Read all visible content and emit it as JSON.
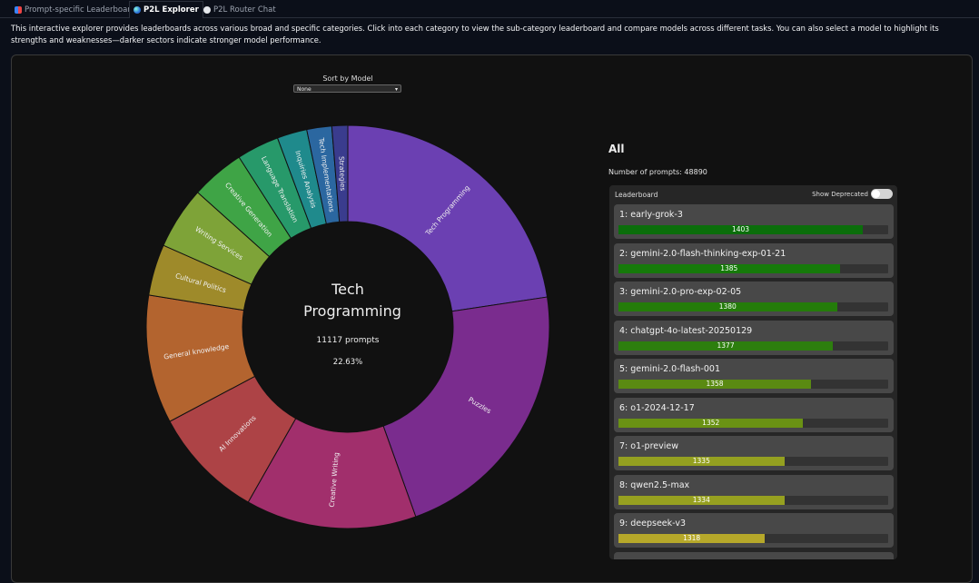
{
  "tabs": [
    {
      "label": "Prompt-specific Leaderboard",
      "icon": "bar-chart-icon",
      "active": false
    },
    {
      "label": "P2L Explorer",
      "icon": "globe-icon",
      "active": true
    },
    {
      "label": "P2L Router Chat",
      "icon": "speech-bubble-icon",
      "active": false
    }
  ],
  "description": "This interactive explorer provides leaderboards across various broad and specific categories. Click into each category to view the sub-category leaderboard and compare models across different tasks. You can also select a model to highlight its strengths and weaknesses—darker sectors indicate stronger model performance.",
  "sort": {
    "label": "Sort by Model",
    "value": "None"
  },
  "center": {
    "title_line1": "Tech",
    "title_line2": "Programming",
    "prompts": "11117 prompts",
    "percent": "22.63%"
  },
  "chart_data": {
    "type": "pie",
    "donut": true,
    "unit": "percent of prompts",
    "categories": [
      {
        "name": "Tech Programming",
        "share": 22.63,
        "color": "#6b40b2"
      },
      {
        "name": "Puzzles",
        "share": 21.9,
        "color": "#7a2c8e"
      },
      {
        "name": "Creative Writing",
        "share": 13.7,
        "color": "#a12f6c"
      },
      {
        "name": "AI Innovations",
        "share": 9.0,
        "color": "#ad4346"
      },
      {
        "name": "General knowledge",
        "share": 10.3,
        "color": "#b3642f"
      },
      {
        "name": "Cultural Politics",
        "share": 4.1,
        "color": "#9e8a2a"
      },
      {
        "name": "Writing Services",
        "share": 5.0,
        "color": "#7ea338"
      },
      {
        "name": "Creative Generation",
        "share": 4.3,
        "color": "#3fa446"
      },
      {
        "name": "Language Translation",
        "share": 3.4,
        "color": "#27996a"
      },
      {
        "name": "Inquiries Analysis",
        "share": 2.4,
        "color": "#1f8a8c"
      },
      {
        "name": "Tech Implementations",
        "share": 2.0,
        "color": "#2b67a0"
      },
      {
        "name": "Strategies",
        "share": 1.27,
        "color": "#3a3c8e"
      }
    ]
  },
  "right": {
    "title": "All",
    "num_prompts": "Number of prompts: 48890"
  },
  "leaderboard": {
    "title": "Leaderboard",
    "show_deprecated_label": "Show Deprecated",
    "show_deprecated": false,
    "items": [
      {
        "label": "1: early-grok-3",
        "score": "1403",
        "fill": 0.906,
        "color": "#0b6e0b"
      },
      {
        "label": "2: gemini-2.0-flash-thinking-exp-01-21",
        "score": "1385",
        "fill": 0.82,
        "color": "#167a0a"
      },
      {
        "label": "3: gemini-2.0-pro-exp-02-05",
        "score": "1380",
        "fill": 0.81,
        "color": "#247c0a"
      },
      {
        "label": "4: chatgpt-4o-latest-20250129",
        "score": "1377",
        "fill": 0.795,
        "color": "#2d7e0e"
      },
      {
        "label": "5: gemini-2.0-flash-001",
        "score": "1358",
        "fill": 0.714,
        "color": "#5a8a12"
      },
      {
        "label": "6: o1-2024-12-17",
        "score": "1352",
        "fill": 0.685,
        "color": "#6a9214"
      },
      {
        "label": "7: o1-preview",
        "score": "1335",
        "fill": 0.615,
        "color": "#94a020"
      },
      {
        "label": "8: qwen2.5-max",
        "score": "1334",
        "fill": 0.615,
        "color": "#96a020"
      },
      {
        "label": "9: deepseek-v3",
        "score": "1318",
        "fill": 0.543,
        "color": "#b6a82a"
      }
    ]
  }
}
